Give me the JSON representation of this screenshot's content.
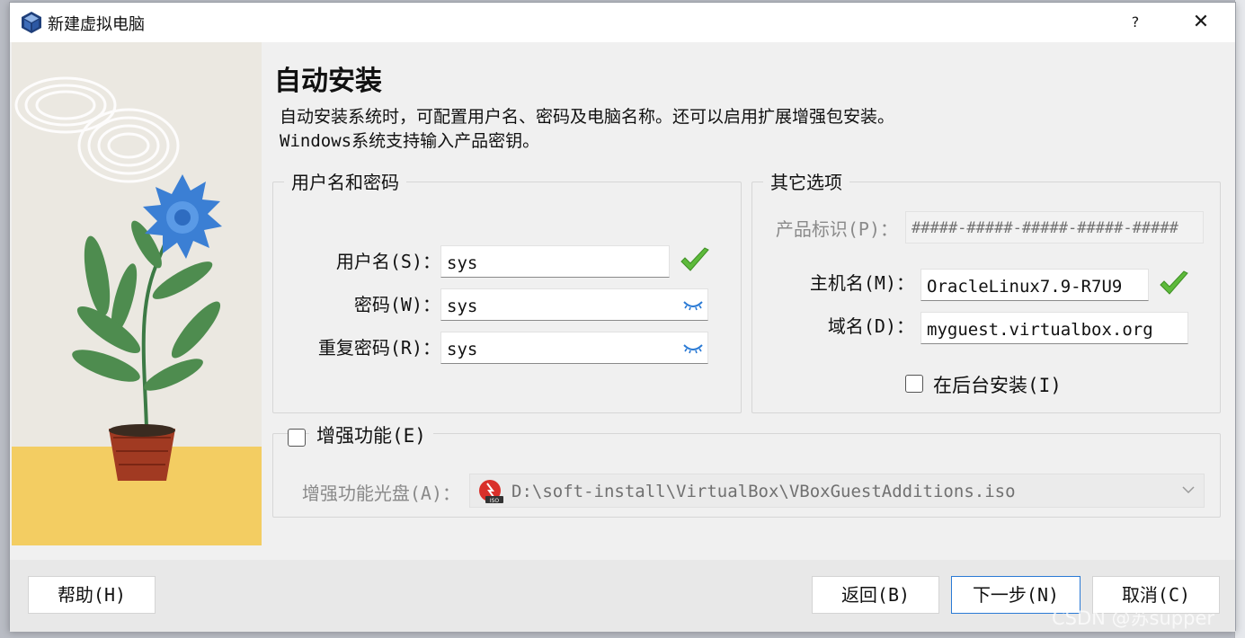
{
  "window": {
    "title": "新建虚拟电脑",
    "help_label": "?",
    "close_label": "✕"
  },
  "page": {
    "heading": "自动安装",
    "description_line1": "自动安装系统时，可配置用户名、密码及电脑名称。还可以启用扩展增强包安装。",
    "description_line2": "Windows系统支持输入产品密钥。"
  },
  "user_group": {
    "title": "用户名和密码",
    "username_label": "用户名(S)：",
    "username_value": "sys",
    "password_label": "密码(W)：",
    "password_value": "sys",
    "repeat_password_label": "重复密码(R)：",
    "repeat_password_value": "sys"
  },
  "other_group": {
    "title": "其它选项",
    "product_key_label": "产品标识(P)：",
    "product_key_value": "#####-#####-#####-#####-#####",
    "hostname_label": "主机名(M)：",
    "hostname_value": "OracleLinux7.9-R7U9",
    "domain_label": "域名(D)：",
    "domain_value": "myguest.virtualbox.org",
    "background_install_label": "在后台安装(I)"
  },
  "additions": {
    "checkbox_label": "增强功能(E)",
    "iso_label": "增强功能光盘(A)：",
    "iso_value": "D:\\soft-install\\VirtualBox\\VBoxGuestAdditions.iso"
  },
  "footer": {
    "help_button": "帮助(H)",
    "back_button": "返回(B)",
    "next_button": "下一步(N)",
    "cancel_button": "取消(C)"
  },
  "watermark": "CSDN @苏supper",
  "colors": {
    "accent": "#2a7ad5",
    "check_green": "#5dba3b",
    "art_sand": "#f3cd62",
    "flower_blue": "#3b7fd4"
  }
}
